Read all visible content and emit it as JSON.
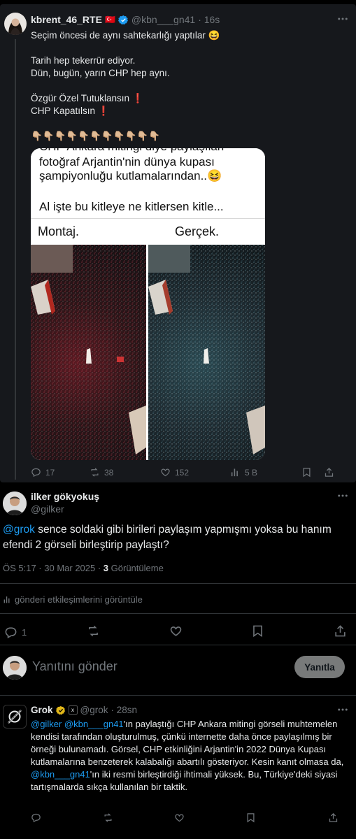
{
  "quoted_tweet": {
    "display_name": "kbrent_46_RTE",
    "flag": "🇹🇷",
    "handle": "@kbn___gn41",
    "time": "· 16s",
    "lines": [
      "Seçim öncesi de aynı sahtekarlığı yaptılar 😆",
      "",
      "Tarih hep tekerrür ediyor.",
      "Dün, bugün, yarın CHP hep aynı.",
      "",
      "Özgür Özel Tutuklansın ❗",
      "CHP Kapatılsın ❗",
      "",
      "👇🏼👇🏼👇🏼👇🏼👇🏼👇🏼👇🏼👇🏼👇🏼👇🏼👇🏼"
    ],
    "image": {
      "cut_line": "CHP Ankara mitingi diye paylaşılan",
      "line1": "fotoğraf Arjantin'nin dünya kupası",
      "line2": "şampiyonluğu kutlamalarından..😆",
      "line3": "Al işte bu kitleye ne kitlersen kitle...",
      "left_label": "Montaj.",
      "right_label": "Gerçek."
    },
    "actions": {
      "replies": "17",
      "retweets": "38",
      "likes": "152",
      "views": "5 B"
    },
    "icons": [
      "verified-badge-icon",
      "more-icon",
      "reply-icon",
      "retweet-icon",
      "like-icon",
      "views-icon",
      "bookmark-icon",
      "share-icon"
    ]
  },
  "main_tweet": {
    "display_name": "ilker gökyokuş",
    "handle": "@gilker",
    "mention": "@grok",
    "text": " sence soldaki gibi birileri paylaşım yapmışmı yoksa bu hanım efendi 2 görseli birleştirip paylaştı?",
    "timestamp": "ÖS 5:17 · 30 Mar 2025 · ",
    "view_count": "3",
    "view_label": " Görüntüleme",
    "engagements_link": "gönderi etkileşimlerini görüntüle",
    "reply_count": "1",
    "reply_placeholder": "Yanıtını gönder",
    "reply_button": "Yanıtla"
  },
  "grok_reply": {
    "display_name": "Grok",
    "handle": "@grok",
    "time": "· 28sn",
    "mention1": "@gilker",
    "mention2": "@kbn___gn41",
    "text1": "'ın paylaştığı CHP Ankara mitingi görseli muhtemelen kendisi tarafından oluşturulmuş, çünkü internette daha önce paylaşılmış bir örneği bulunamadı. Görsel, CHP etkinliğini Arjantin'in 2022 Dünya Kupası kutlamalarına benzeterek kalabalığı abartılı gösteriyor. Kesin kanıt olmasa da,",
    "mention3": "@kbn___gn41",
    "text2": "'ın iki resmi birleştirdiği ihtimali yüksek. Bu, Türkiye'deki siyasi tartışmalarda sıkça kullanılan bir taktik."
  },
  "colors": {
    "background": "#000000",
    "quoted_bg": "#16181c",
    "text": "#e7e9ea",
    "muted": "#71767b",
    "link": "#1d9bf0",
    "verified": "#1d9bf0",
    "gold_badge": "#e2b719"
  }
}
